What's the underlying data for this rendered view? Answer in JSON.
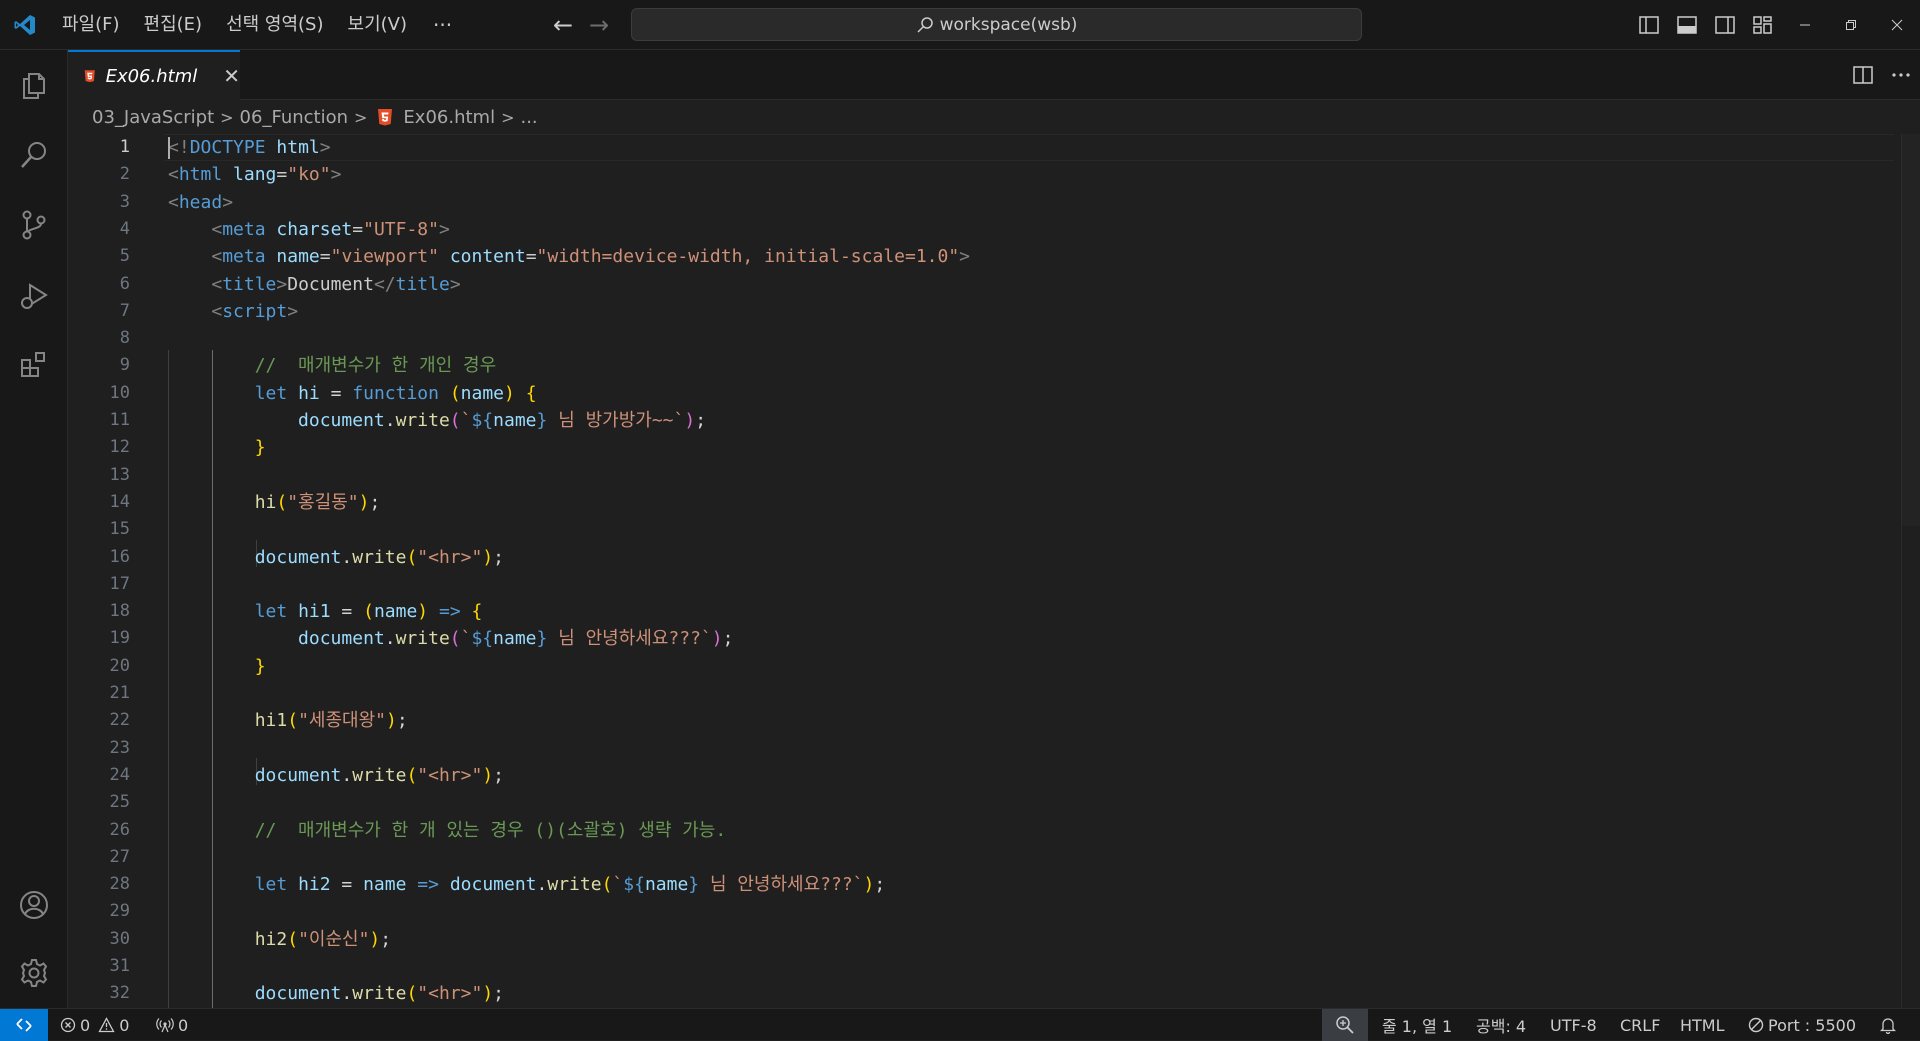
{
  "titlebar": {
    "menus": [
      "파일(F)",
      "편집(E)",
      "선택 영역(S)",
      "보기(V)"
    ],
    "more": "···",
    "search_text": "workspace(wsb)"
  },
  "tab": {
    "label": "Ex06.html",
    "close": "✕"
  },
  "breadcrumb": {
    "folder1": "03_JavaScript",
    "folder2": "06_Function",
    "file": "Ex06.html",
    "more": "..."
  },
  "editor": {
    "active_line": 1,
    "lines": [
      [
        [
          "t-pun",
          "<"
        ],
        [
          "t-pun",
          "!"
        ],
        [
          "t-tag",
          "DOCTYPE"
        ],
        [
          "t-txt",
          " "
        ],
        [
          "t-attr",
          "html"
        ],
        [
          "t-pun",
          ">"
        ]
      ],
      [
        [
          "t-pun",
          "<"
        ],
        [
          "t-tag",
          "html"
        ],
        [
          "t-txt",
          " "
        ],
        [
          "t-attr",
          "lang"
        ],
        [
          "t-txt",
          "="
        ],
        [
          "t-str",
          "\"ko\""
        ],
        [
          "t-pun",
          ">"
        ]
      ],
      [
        [
          "t-pun",
          "<"
        ],
        [
          "t-tag",
          "head"
        ],
        [
          "t-pun",
          ">"
        ]
      ],
      [
        [
          "t-txt",
          "    "
        ],
        [
          "t-pun",
          "<"
        ],
        [
          "t-tag",
          "meta"
        ],
        [
          "t-txt",
          " "
        ],
        [
          "t-attr",
          "charset"
        ],
        [
          "t-txt",
          "="
        ],
        [
          "t-str",
          "\"UTF-8\""
        ],
        [
          "t-pun",
          ">"
        ]
      ],
      [
        [
          "t-txt",
          "    "
        ],
        [
          "t-pun",
          "<"
        ],
        [
          "t-tag",
          "meta"
        ],
        [
          "t-txt",
          " "
        ],
        [
          "t-attr",
          "name"
        ],
        [
          "t-txt",
          "="
        ],
        [
          "t-str",
          "\"viewport\""
        ],
        [
          "t-txt",
          " "
        ],
        [
          "t-attr",
          "content"
        ],
        [
          "t-txt",
          "="
        ],
        [
          "t-str",
          "\"width=device-width, initial-scale=1.0\""
        ],
        [
          "t-pun",
          ">"
        ]
      ],
      [
        [
          "t-txt",
          "    "
        ],
        [
          "t-pun",
          "<"
        ],
        [
          "t-tag",
          "title"
        ],
        [
          "t-pun",
          ">"
        ],
        [
          "t-txt",
          "Document"
        ],
        [
          "t-pun",
          "</"
        ],
        [
          "t-tag",
          "title"
        ],
        [
          "t-pun",
          ">"
        ]
      ],
      [
        [
          "t-txt",
          "    "
        ],
        [
          "t-pun",
          "<"
        ],
        [
          "t-tag",
          "script"
        ],
        [
          "t-pun",
          ">"
        ]
      ],
      [],
      [
        [
          "t-txt",
          "        "
        ],
        [
          "t-com",
          "//  매개변수가 한 개인 경우"
        ]
      ],
      [
        [
          "t-txt",
          "        "
        ],
        [
          "t-kw",
          "let"
        ],
        [
          "t-txt",
          " "
        ],
        [
          "t-var",
          "hi"
        ],
        [
          "t-op",
          " = "
        ],
        [
          "t-kw",
          "function"
        ],
        [
          "t-txt",
          " "
        ],
        [
          "t-b1",
          "("
        ],
        [
          "t-var",
          "name"
        ],
        [
          "t-b1",
          ")"
        ],
        [
          "t-txt",
          " "
        ],
        [
          "t-b1",
          "{"
        ]
      ],
      [
        [
          "t-txt",
          "            "
        ],
        [
          "t-var",
          "document"
        ],
        [
          "t-op",
          "."
        ],
        [
          "t-fn",
          "write"
        ],
        [
          "t-b2",
          "("
        ],
        [
          "t-str",
          "`"
        ],
        [
          "t-tmpl",
          "${"
        ],
        [
          "t-var",
          "name"
        ],
        [
          "t-tmpl",
          "}"
        ],
        [
          "t-str",
          " 님 방가방가~~`"
        ],
        [
          "t-b2",
          ")"
        ],
        [
          "t-op",
          ";"
        ]
      ],
      [
        [
          "t-txt",
          "        "
        ],
        [
          "t-b1",
          "}"
        ]
      ],
      [],
      [
        [
          "t-txt",
          "        "
        ],
        [
          "t-fn",
          "hi"
        ],
        [
          "t-b1",
          "("
        ],
        [
          "t-str",
          "\"홍길동\""
        ],
        [
          "t-b1",
          ")"
        ],
        [
          "t-op",
          ";"
        ]
      ],
      [],
      [
        [
          "t-txt",
          "        "
        ],
        [
          "t-var",
          "document"
        ],
        [
          "t-op",
          "."
        ],
        [
          "t-fn",
          "write"
        ],
        [
          "t-b1",
          "("
        ],
        [
          "t-str",
          "\"<hr>\""
        ],
        [
          "t-b1",
          ")"
        ],
        [
          "t-op",
          ";"
        ]
      ],
      [],
      [
        [
          "t-txt",
          "        "
        ],
        [
          "t-kw",
          "let"
        ],
        [
          "t-txt",
          " "
        ],
        [
          "t-var",
          "hi1"
        ],
        [
          "t-op",
          " = "
        ],
        [
          "t-b1",
          "("
        ],
        [
          "t-var",
          "name"
        ],
        [
          "t-b1",
          ")"
        ],
        [
          "t-txt",
          " "
        ],
        [
          "t-kw",
          "=>"
        ],
        [
          "t-txt",
          " "
        ],
        [
          "t-b1",
          "{"
        ]
      ],
      [
        [
          "t-txt",
          "            "
        ],
        [
          "t-var",
          "document"
        ],
        [
          "t-op",
          "."
        ],
        [
          "t-fn",
          "write"
        ],
        [
          "t-b2",
          "("
        ],
        [
          "t-str",
          "`"
        ],
        [
          "t-tmpl",
          "${"
        ],
        [
          "t-var",
          "name"
        ],
        [
          "t-tmpl",
          "}"
        ],
        [
          "t-str",
          " 님 안녕하세요???`"
        ],
        [
          "t-b2",
          ")"
        ],
        [
          "t-op",
          ";"
        ]
      ],
      [
        [
          "t-txt",
          "        "
        ],
        [
          "t-b1",
          "}"
        ]
      ],
      [],
      [
        [
          "t-txt",
          "        "
        ],
        [
          "t-fn",
          "hi1"
        ],
        [
          "t-b1",
          "("
        ],
        [
          "t-str",
          "\"세종대왕\""
        ],
        [
          "t-b1",
          ")"
        ],
        [
          "t-op",
          ";"
        ]
      ],
      [],
      [
        [
          "t-txt",
          "        "
        ],
        [
          "t-var",
          "document"
        ],
        [
          "t-op",
          "."
        ],
        [
          "t-fn",
          "write"
        ],
        [
          "t-b1",
          "("
        ],
        [
          "t-str",
          "\"<hr>\""
        ],
        [
          "t-b1",
          ")"
        ],
        [
          "t-op",
          ";"
        ]
      ],
      [],
      [
        [
          "t-txt",
          "        "
        ],
        [
          "t-com",
          "//  매개변수가 한 개 있는 경우 ()(소괄호) 생략 가능."
        ]
      ],
      [],
      [
        [
          "t-txt",
          "        "
        ],
        [
          "t-kw",
          "let"
        ],
        [
          "t-txt",
          " "
        ],
        [
          "t-var",
          "hi2"
        ],
        [
          "t-op",
          " = "
        ],
        [
          "t-var",
          "name"
        ],
        [
          "t-txt",
          " "
        ],
        [
          "t-kw",
          "=>"
        ],
        [
          "t-txt",
          " "
        ],
        [
          "t-var",
          "document"
        ],
        [
          "t-op",
          "."
        ],
        [
          "t-fn",
          "write"
        ],
        [
          "t-b1",
          "("
        ],
        [
          "t-str",
          "`"
        ],
        [
          "t-tmpl",
          "${"
        ],
        [
          "t-var",
          "name"
        ],
        [
          "t-tmpl",
          "}"
        ],
        [
          "t-str",
          " 님 안녕하세요???`"
        ],
        [
          "t-b1",
          ")"
        ],
        [
          "t-op",
          ";"
        ]
      ],
      [],
      [
        [
          "t-txt",
          "        "
        ],
        [
          "t-fn",
          "hi2"
        ],
        [
          "t-b1",
          "("
        ],
        [
          "t-str",
          "\"이순신\""
        ],
        [
          "t-b1",
          ")"
        ],
        [
          "t-op",
          ";"
        ]
      ],
      [],
      [
        [
          "t-txt",
          "        "
        ],
        [
          "t-var",
          "document"
        ],
        [
          "t-op",
          "."
        ],
        [
          "t-fn",
          "write"
        ],
        [
          "t-b1",
          "("
        ],
        [
          "t-str",
          "\"<hr>\""
        ],
        [
          "t-b1",
          ")"
        ],
        [
          "t-op",
          ";"
        ]
      ]
    ]
  },
  "statusbar": {
    "errors": "0",
    "warnings": "0",
    "ports": "0",
    "position": "줄 1, 열 1",
    "spaces": "공백: 4",
    "encoding": "UTF-8",
    "eol": "CRLF",
    "language": "HTML",
    "port": "Port : 5500"
  },
  "colors": {
    "accent": "#0078d4",
    "html_icon": "#e44d26"
  }
}
